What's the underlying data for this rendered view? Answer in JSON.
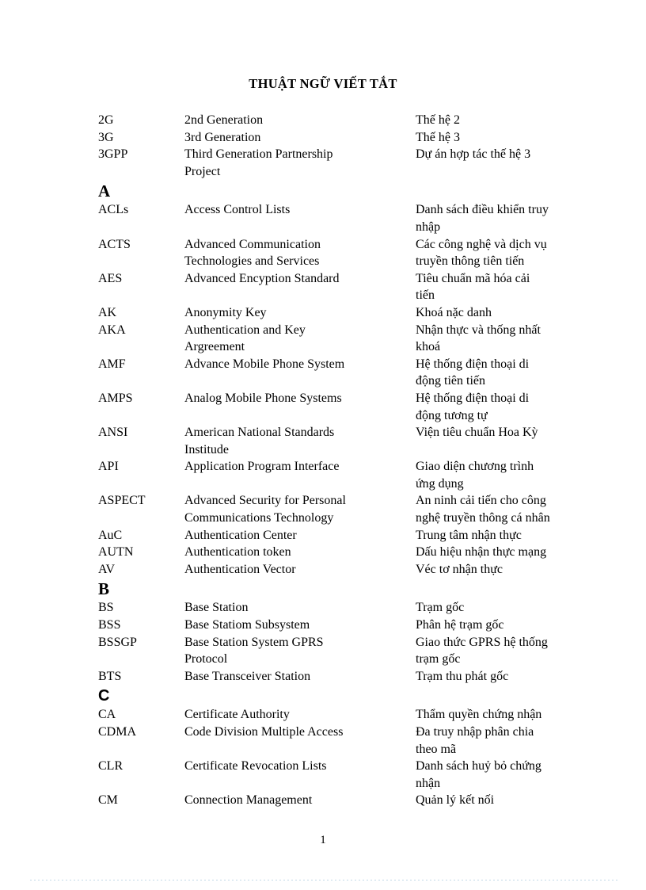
{
  "document": {
    "title": "THUẬT NGỮ VIẾT TẮT",
    "page_number": "1"
  },
  "entries": [
    {
      "kind": "entry",
      "abbr": "2G",
      "english": [
        "2nd Generation"
      ],
      "vietnamese": [
        "Thế hệ 2"
      ]
    },
    {
      "kind": "entry",
      "abbr": "3G",
      "english": [
        "3rd Generation"
      ],
      "vietnamese": [
        "Thế hệ 3"
      ]
    },
    {
      "kind": "entry",
      "abbr": "3GPP",
      "english": [
        "Third Generation Partnership",
        "Project"
      ],
      "vietnamese": [
        "Dự án hợp tác thế hệ 3"
      ]
    },
    {
      "kind": "section",
      "letter": "A",
      "style": "serif"
    },
    {
      "kind": "entry",
      "abbr": "ACLs",
      "english": [
        "Access Control Lists"
      ],
      "vietnamese": [
        "Danh sách điều khiển truy",
        "nhập"
      ]
    },
    {
      "kind": "entry",
      "abbr": "ACTS",
      "english": [
        "Advanced Communication",
        "Technologies and Services"
      ],
      "vietnamese": [
        "Các công nghệ và dịch vụ",
        "truyền thông tiên tiến"
      ]
    },
    {
      "kind": "entry",
      "abbr": "AES",
      "english": [
        "Advanced Encyption Standard"
      ],
      "vietnamese": [
        "Tiêu chuẩn mã hóa cải",
        "tiến"
      ]
    },
    {
      "kind": "entry",
      "abbr": "AK",
      "english": [
        "Anonymity Key"
      ],
      "vietnamese": [
        "Khoá nặc danh"
      ]
    },
    {
      "kind": "entry",
      "abbr": "AKA",
      "english": [
        "Authentication and Key",
        "Argreement"
      ],
      "vietnamese": [
        "Nhận thực và thống nhất",
        "khoá"
      ]
    },
    {
      "kind": "entry",
      "abbr": "AMF",
      "english": [
        "Advance Mobile Phone System"
      ],
      "vietnamese": [
        "Hệ thống điện thoại di",
        "động tiên tiến"
      ]
    },
    {
      "kind": "entry",
      "abbr": "AMPS",
      "english": [
        "Analog Mobile Phone Systems"
      ],
      "vietnamese": [
        "Hệ thống điện thoại di",
        "động tương tự"
      ]
    },
    {
      "kind": "entry",
      "abbr": "ANSI",
      "english": [
        "American National Standards",
        "Institude"
      ],
      "vietnamese": [
        "Viện tiêu chuẩn Hoa Kỳ"
      ]
    },
    {
      "kind": "entry",
      "abbr": "API",
      "english": [
        "Application Program Interface"
      ],
      "vietnamese": [
        "Giao diện chương trình",
        "ứng dụng"
      ]
    },
    {
      "kind": "entry",
      "abbr": "ASPECT",
      "english": [
        "Advanced Security for Personal",
        "Communications Technology"
      ],
      "vietnamese": [
        "An ninh cải tiến cho công",
        "nghệ truyền thông cá nhân"
      ]
    },
    {
      "kind": "entry",
      "abbr": "AuC",
      "english": [
        "Authentication Center"
      ],
      "vietnamese": [
        "Trung tâm nhận thực"
      ]
    },
    {
      "kind": "entry",
      "abbr": "AUTN",
      "english": [
        "Authentication token"
      ],
      "vietnamese": [
        " Dấu hiệu nhận thực mạng"
      ]
    },
    {
      "kind": "entry",
      "abbr": "AV",
      "english": [
        "Authentication Vector"
      ],
      "vietnamese": [
        "Véc tơ nhận thực"
      ]
    },
    {
      "kind": "section",
      "letter": "B",
      "style": "serif"
    },
    {
      "kind": "entry",
      "abbr": "BS",
      "english": [
        "Base Station"
      ],
      "vietnamese": [
        "Trạm gốc"
      ]
    },
    {
      "kind": "entry",
      "abbr": "BSS",
      "english": [
        "Base Statiom Subsystem"
      ],
      "vietnamese": [
        "Phân hệ trạm gốc"
      ]
    },
    {
      "kind": "entry",
      "abbr": "BSSGP",
      "english": [
        "Base Station System GPRS",
        "Protocol"
      ],
      "vietnamese": [
        "Giao thức GPRS hệ thống",
        "trạm gốc"
      ]
    },
    {
      "kind": "entry",
      "abbr": "BTS",
      "english": [
        "Base Transceiver Station"
      ],
      "vietnamese": [
        "Trạm thu phát gốc"
      ]
    },
    {
      "kind": "section",
      "letter": "C",
      "style": "sans"
    },
    {
      "kind": "entry",
      "abbr": "CA",
      "english": [
        "Certificate Authority"
      ],
      "vietnamese": [
        "Thẩm quyền chứng nhận"
      ]
    },
    {
      "kind": "entry",
      "abbr": "CDMA",
      "english": [
        "Code Division Multiple Access"
      ],
      "vietnamese": [
        "Đa truy nhập phân chia",
        "theo mã"
      ]
    },
    {
      "kind": "entry",
      "abbr": "CLR",
      "english": [
        "Certificate Revocation Lists"
      ],
      "vietnamese": [
        "Danh sách huỷ bỏ chứng",
        "nhận"
      ]
    },
    {
      "kind": "entry",
      "abbr": "CM",
      "english": [
        "Connection Management"
      ],
      "vietnamese": [
        "Quản lý kết nối"
      ]
    }
  ]
}
